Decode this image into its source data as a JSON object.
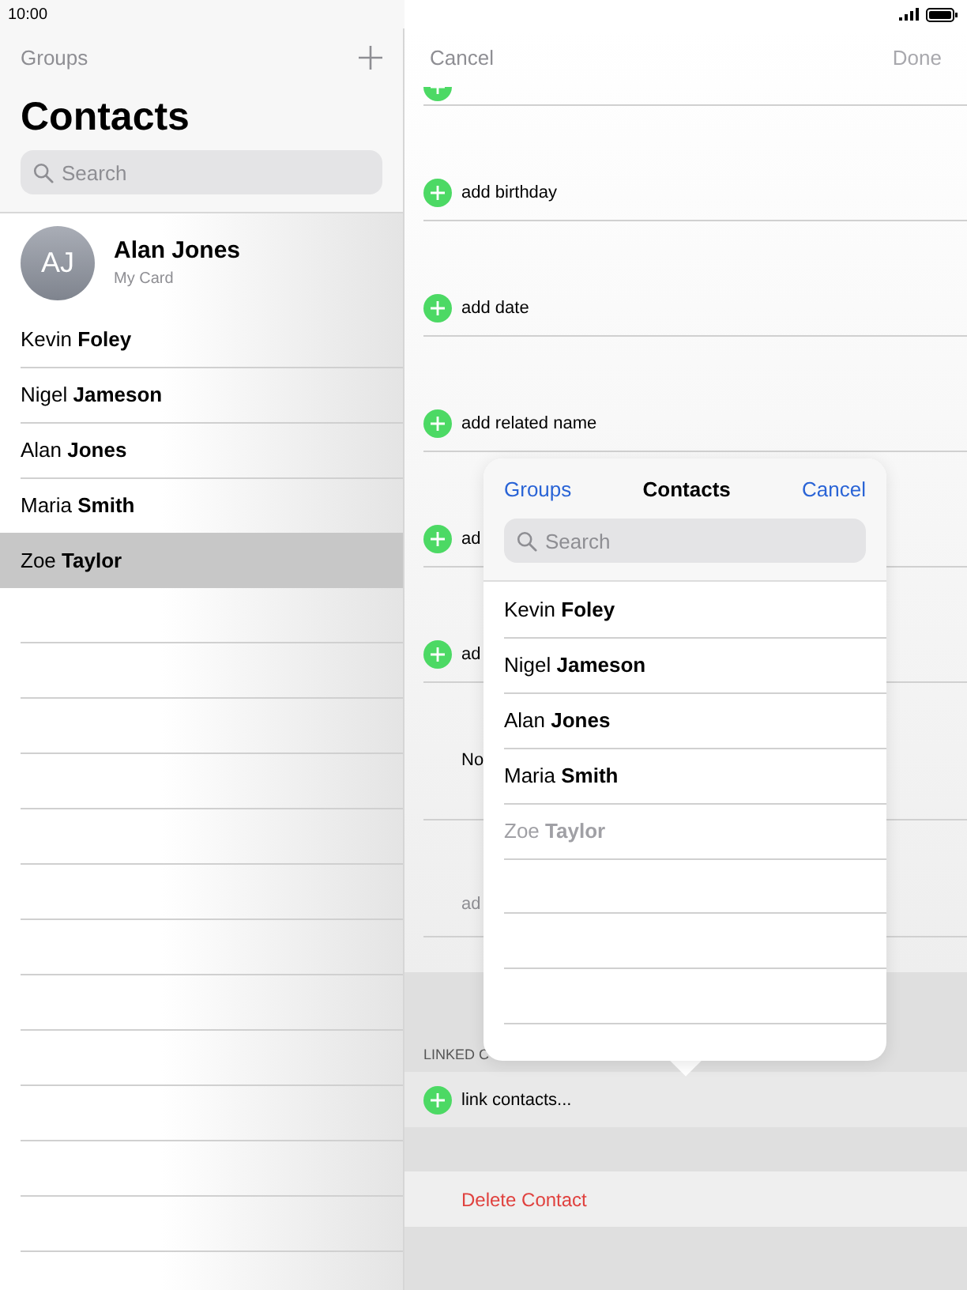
{
  "status_bar": {
    "time": "10:00"
  },
  "contacts_list": {
    "groups_button": "Groups",
    "title": "Contacts",
    "search": {
      "placeholder": "Search"
    },
    "my_card": {
      "initials": "AJ",
      "name": "Alan Jones",
      "subtitle": "My Card"
    },
    "contacts": [
      {
        "name": "Kevin **Foley**",
        "selected": false
      },
      {
        "name": "Nigel **Jameson**",
        "selected": false
      },
      {
        "name": "Alan **Jones**",
        "selected": false
      },
      {
        "name": "Maria **Smith**",
        "selected": false
      },
      {
        "name": "Zoe **Taylor**",
        "selected": true
      }
    ]
  },
  "edit_contact": {
    "cancel": "Cancel",
    "done": {
      "label": "Done",
      "disabled": true
    },
    "fields": [
      {
        "kind": "partial"
      },
      {
        "kind": "add",
        "label": "add birthday"
      },
      {
        "kind": "add",
        "label": "add date"
      },
      {
        "kind": "add",
        "label": "add related name"
      },
      {
        "kind": "add",
        "label": "ad"
      },
      {
        "kind": "add",
        "label": "ad"
      },
      {
        "kind": "plain",
        "label": "No"
      },
      {
        "kind": "muted",
        "label": "ad"
      }
    ],
    "linked_header": "LINKED C",
    "link_button": "link contacts...",
    "delete_button": "Delete Contact"
  },
  "popover": {
    "left_button": "Groups",
    "title": "Contacts",
    "right_button": "Cancel",
    "search": {
      "placeholder": "Search"
    },
    "contacts": [
      {
        "name": "Kevin **Foley**",
        "disabled": false
      },
      {
        "name": "Nigel **Jameson**",
        "disabled": false
      },
      {
        "name": "Alan **Jones**",
        "disabled": false
      },
      {
        "name": "Maria **Smith**",
        "disabled": false
      },
      {
        "name": "Zoe **Taylor**",
        "disabled": true
      }
    ]
  }
}
